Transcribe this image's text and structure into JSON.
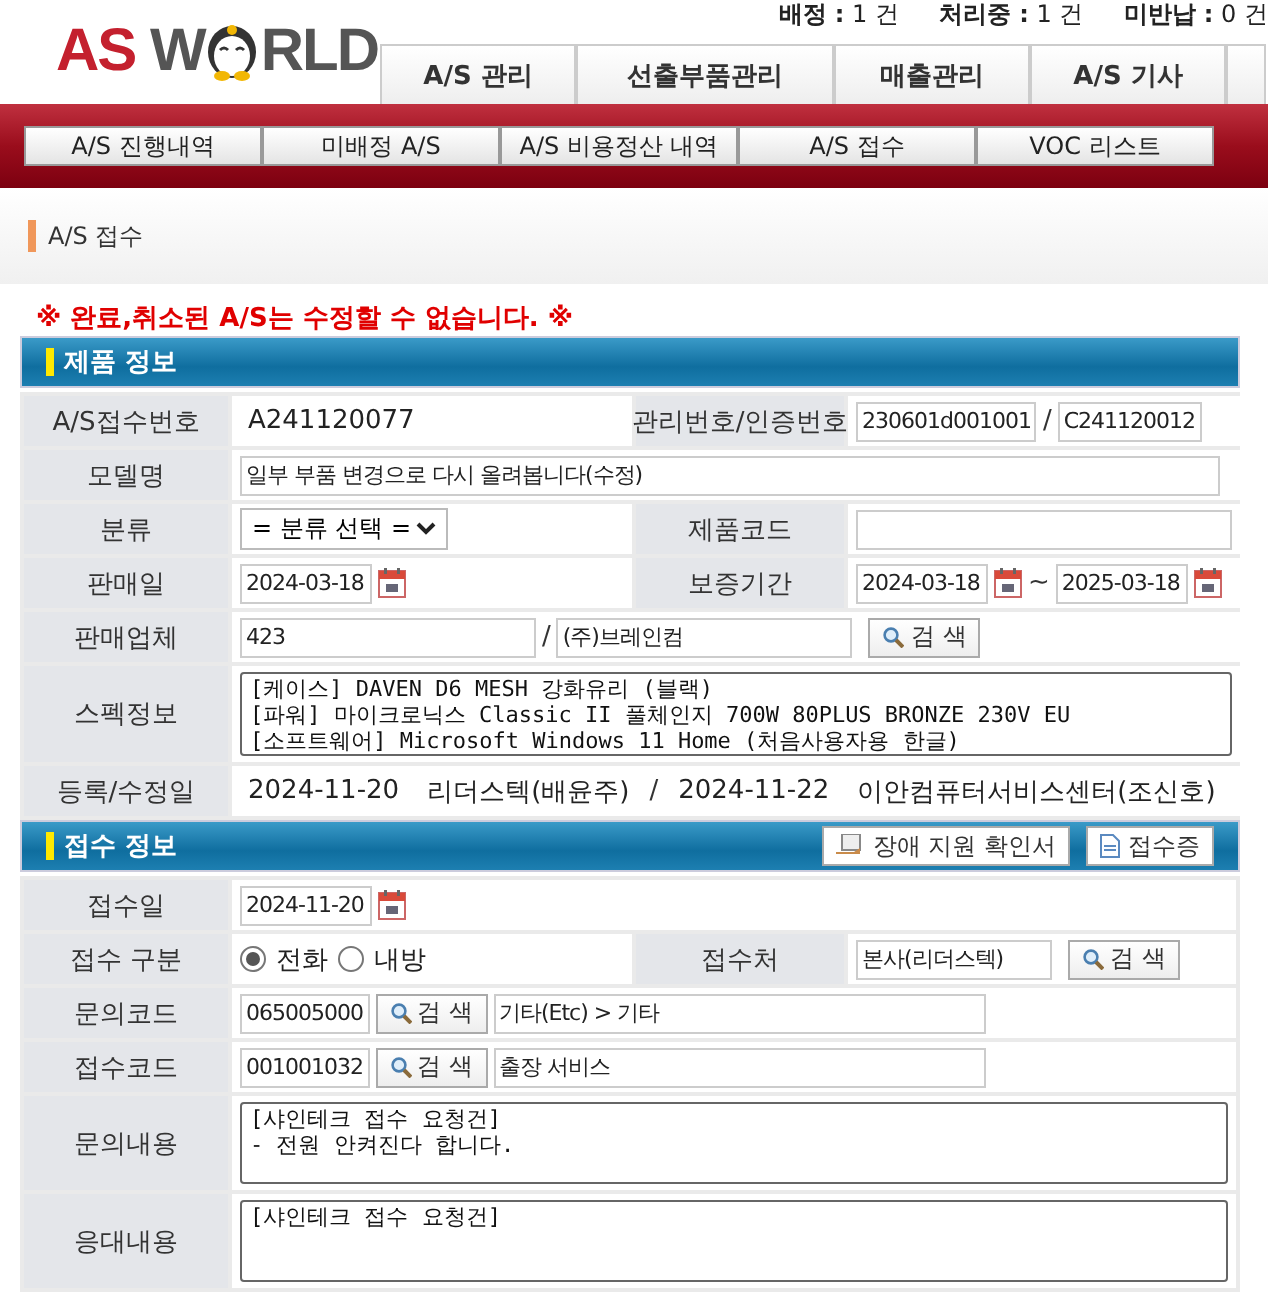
{
  "header": {
    "logo": [
      "AS",
      "W",
      "RLD"
    ],
    "stats": [
      "**배정 :** 1 건",
      "**처리중 :** 1 건",
      "**미반납 :** 0 건"
    ],
    "main_tabs": [
      {
        "label": "A/S 관리"
      },
      {
        "label": "선출부품관리"
      },
      {
        "label": "매출관리"
      },
      {
        "label": "A/S 기사"
      }
    ],
    "sub_tabs": [
      {
        "label": "A/S 진행내역"
      },
      {
        "label": "미배정 A/S"
      },
      {
        "label": "A/S 비용정산 내역"
      },
      {
        "label": "A/S 접수"
      },
      {
        "label": "VOC 리스트"
      }
    ]
  },
  "breadcrumb": "A/S 접수",
  "notice": "※ 완료,취소된 A/S는 수정할 수 없습니다. ※",
  "product_info": {
    "title": "제품 정보",
    "receipt_no": {
      "label": "A/S접수번호",
      "value": "A241120077"
    },
    "manage_no": {
      "label": "관리번호/인증번호",
      "value": "230601d001001",
      "separator": "/",
      "cert_value": "C241120012"
    },
    "model": {
      "label": "모델명",
      "value": "일부 부품 변경으로 다시 올려봅니다(수정)"
    },
    "category": {
      "label": "분류",
      "value": "= 분류 선택 ="
    },
    "product_code": {
      "label": "제품코드"
    },
    "sale_date": {
      "label": "판매일",
      "value": "2024-03-18"
    },
    "warranty": {
      "label": "보증기간",
      "start": "2024-03-18",
      "separator": "~",
      "end": "2025-03-18"
    },
    "vendor": {
      "label": "판매업체",
      "code": "423",
      "separator": "/",
      "name": "(주)브레인컴",
      "button": "검 색"
    },
    "spec": {
      "label": "스펙정보",
      "lines": [
        "[케이스] DAVEN D6 MESH 강화유리 (블랙)",
        "[파워] 마이크로닉스 Classic II 풀체인지 700W 80PLUS BRONZE 230V EU",
        "[소프트웨어] Microsoft Windows 11 Home (처음사용자용 한글)"
      ]
    },
    "dates": {
      "label": "등록/수정일",
      "registered": "2024-11-20",
      "registered_by": "리더스텍(배윤주)",
      "separator": "/",
      "modified": "2024-11-22",
      "modified_by": "이안컴퓨터서비스센터(조신호)"
    }
  },
  "receipt_info": {
    "title": "접수 정보",
    "buttons": [
      "장애 지원 확인서",
      "접수증"
    ],
    "date": {
      "label": "접수일",
      "value": "2024-11-20"
    },
    "type": {
      "label": "접수 구분",
      "options": [
        {
          "label": "전화",
          "selected": true
        },
        {
          "label": "내방",
          "selected": false
        }
      ]
    },
    "place": {
      "label": "접수처",
      "value": "본사(리더스텍)",
      "button": "검 색"
    },
    "inquiry_code": {
      "label": "문의코드",
      "value": "065005000",
      "button": "검 색",
      "name": "기타(Etc) > 기타"
    },
    "receipt_code": {
      "label": "접수코드",
      "value": "001001032",
      "button": "검 색",
      "name": "출장 서비스"
    },
    "inquiry": {
      "label": "문의내용",
      "lines": [
        "[샤인테크 접수 요청건]",
        "- 전원 안켜진다 합니다."
      ]
    },
    "response": {
      "label": "응대내용",
      "lines": [
        "[샤인테크 접수 요청건]"
      ]
    }
  }
}
